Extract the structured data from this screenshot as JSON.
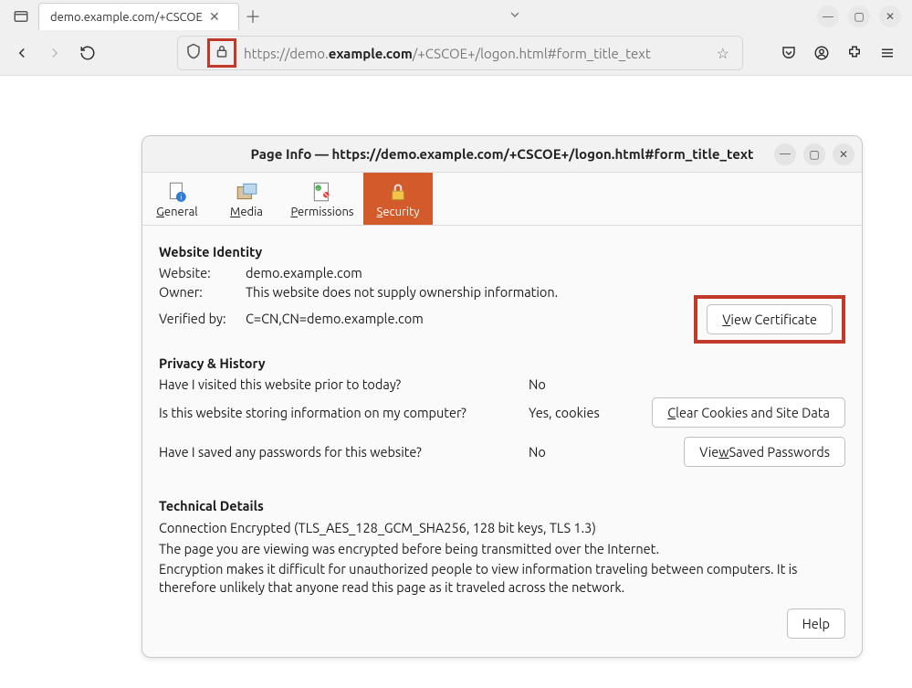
{
  "browser": {
    "tab_title": "demo.example.com/+CSCOE",
    "url_prefix": "https://demo.",
    "url_bold": "example.com",
    "url_suffix": "/+CSCOE+/logon.html#form_title_text"
  },
  "dialog": {
    "title": "Page Info — https://demo.example.com/+CSCOE+/logon.html#form_title_text",
    "tabs": {
      "general": "eneral",
      "media": "edia",
      "permissions": "ermissions",
      "security": "ecurity"
    },
    "identity": {
      "heading": "Website Identity",
      "website_label": "Website:",
      "website_value": "demo.example.com",
      "owner_label": "Owner:",
      "owner_value": "This website does not supply ownership information.",
      "verified_label": "Verified by:",
      "verified_value": "C=CN,CN=demo.example.com",
      "view_cert": "iew Certificate"
    },
    "privacy": {
      "heading": "Privacy & History",
      "q1": "Have I visited this website prior to today?",
      "a1": "No",
      "q2": "Is this website storing information on my computer?",
      "a2": "Yes, cookies",
      "clear_btn": "lear Cookies and Site Data",
      "q3": "Have I saved any passwords for this website?",
      "a3": "No",
      "view_pw_pre": "Vie",
      "view_pw_post": " Saved Passwords"
    },
    "technical": {
      "heading": "Technical Details",
      "line1": "Connection Encrypted (TLS_AES_128_GCM_SHA256, 128 bit keys, TLS 1.3)",
      "line2": "The page you are viewing was encrypted before being transmitted over the Internet.",
      "line3": "Encryption makes it difficult for unauthorized people to view information traveling between computers. It is therefore unlikely that anyone read this page as it traveled across the network.",
      "help": "Help"
    }
  }
}
